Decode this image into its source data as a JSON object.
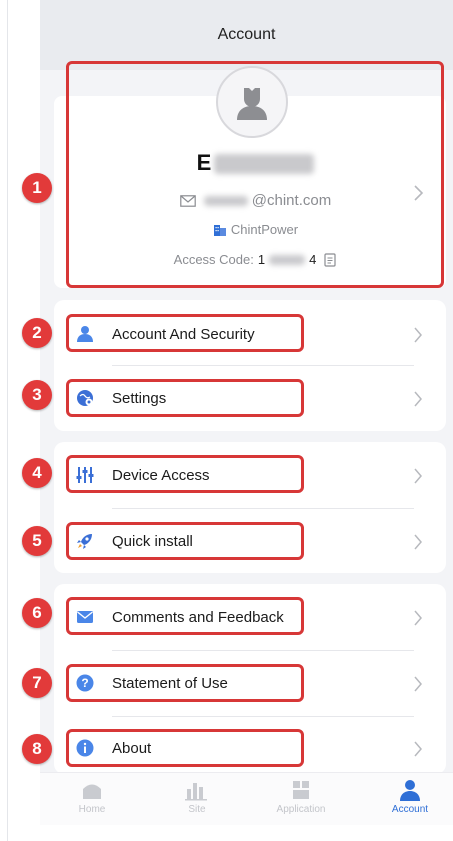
{
  "header": {
    "title": "Account"
  },
  "profile": {
    "name_visible_prefix": "E",
    "email_suffix": "@chint.com",
    "company": "ChintPower",
    "access_code_label": "Access Code:",
    "access_code_start": "1",
    "access_code_end": "4"
  },
  "menu": {
    "group1": [
      {
        "label": "Account And Security",
        "icon": "person-icon",
        "color": "#4a86e8"
      },
      {
        "label": "Settings",
        "icon": "globe-gear-icon",
        "color": "#3b6fd6"
      }
    ],
    "group2": [
      {
        "label": "Device Access",
        "icon": "sliders-icon",
        "color": "#3b6fd6"
      },
      {
        "label": "Quick install",
        "icon": "rocket-icon",
        "color": "#3b6fd6"
      }
    ],
    "group3": [
      {
        "label": "Comments and Feedback",
        "icon": "envelope-icon",
        "color": "#4a86e8"
      },
      {
        "label": "Statement of Use",
        "icon": "question-icon",
        "color": "#4a86e8"
      },
      {
        "label": "About",
        "icon": "info-icon",
        "color": "#4a86e8"
      }
    ]
  },
  "badges": [
    "1",
    "2",
    "3",
    "4",
    "5",
    "6",
    "7",
    "8"
  ],
  "tabs": [
    {
      "label": "Home",
      "icon": "home-icon",
      "active": false
    },
    {
      "label": "Site",
      "icon": "bar-chart-icon",
      "active": false
    },
    {
      "label": "Application",
      "icon": "app-box-icon",
      "active": false
    },
    {
      "label": "Account",
      "icon": "person-icon",
      "active": true
    }
  ],
  "colors": {
    "accent": "#2f6fd6",
    "highlight": "#d73737",
    "badge": "#e23a3a"
  }
}
